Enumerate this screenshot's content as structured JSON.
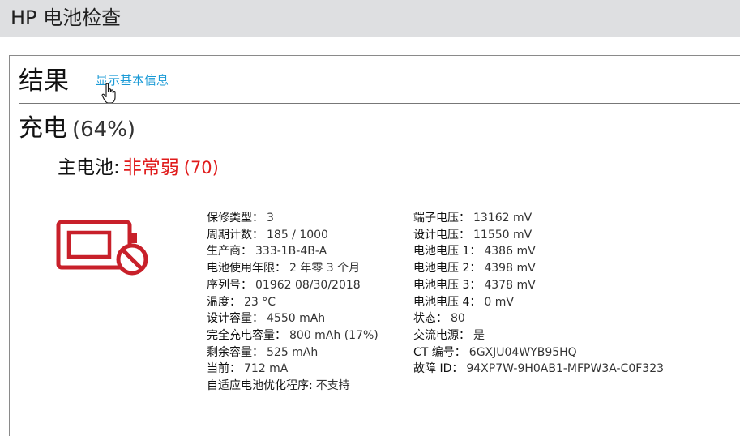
{
  "window": {
    "title": "HP 电池检查"
  },
  "results": {
    "heading": "结果",
    "basic_info_link": "显示基本信息"
  },
  "charge": {
    "label": "充电",
    "percent": "(64%)"
  },
  "main_battery": {
    "label": "主电池:",
    "status": "非常弱",
    "score": "(70)",
    "status_color": "#e01b1b"
  },
  "icon": {
    "name": "battery-error-icon",
    "color": "#c8202a"
  },
  "details_left": [
    {
      "key": "保修类型：",
      "value": "3"
    },
    {
      "key": "周期计数：",
      "value": "185 / 1000"
    },
    {
      "key": "生产商：",
      "value": "333-1B-4B-A"
    },
    {
      "key": "电池使用年限：",
      "value": "2 年零 3 个月"
    },
    {
      "key": "序列号：",
      "value": "01962 08/30/2018"
    },
    {
      "key": "温度：",
      "value": "23 °C"
    },
    {
      "key": "设计容量：",
      "value": "4550 mAh"
    },
    {
      "key": "完全充电容量：",
      "value": "800 mAh (17%)"
    },
    {
      "key": "剩余容量：",
      "value": "525 mAh"
    },
    {
      "key": "当前：",
      "value": "712 mA"
    },
    {
      "key": "自适应电池优化程序:",
      "value": "不支持"
    }
  ],
  "details_right": [
    {
      "key": "端子电压：",
      "value": "13162 mV"
    },
    {
      "key": "设计电压：",
      "value": "11550 mV"
    },
    {
      "key": "电池电压 1：",
      "value": "4386 mV"
    },
    {
      "key": "电池电压 2：",
      "value": "4398 mV"
    },
    {
      "key": "电池电压 3：",
      "value": "4378 mV"
    },
    {
      "key": "电池电压 4：",
      "value": "0 mV"
    },
    {
      "key": "状态：",
      "value": "80"
    },
    {
      "key": "交流电源：",
      "value": "是"
    },
    {
      "key": "CT 编号：",
      "value": "6GXJU04WYB95HQ"
    },
    {
      "key": "故障 ID：",
      "value": "94XP7W-9H0AB1-MFPW3A-C0F323"
    }
  ]
}
